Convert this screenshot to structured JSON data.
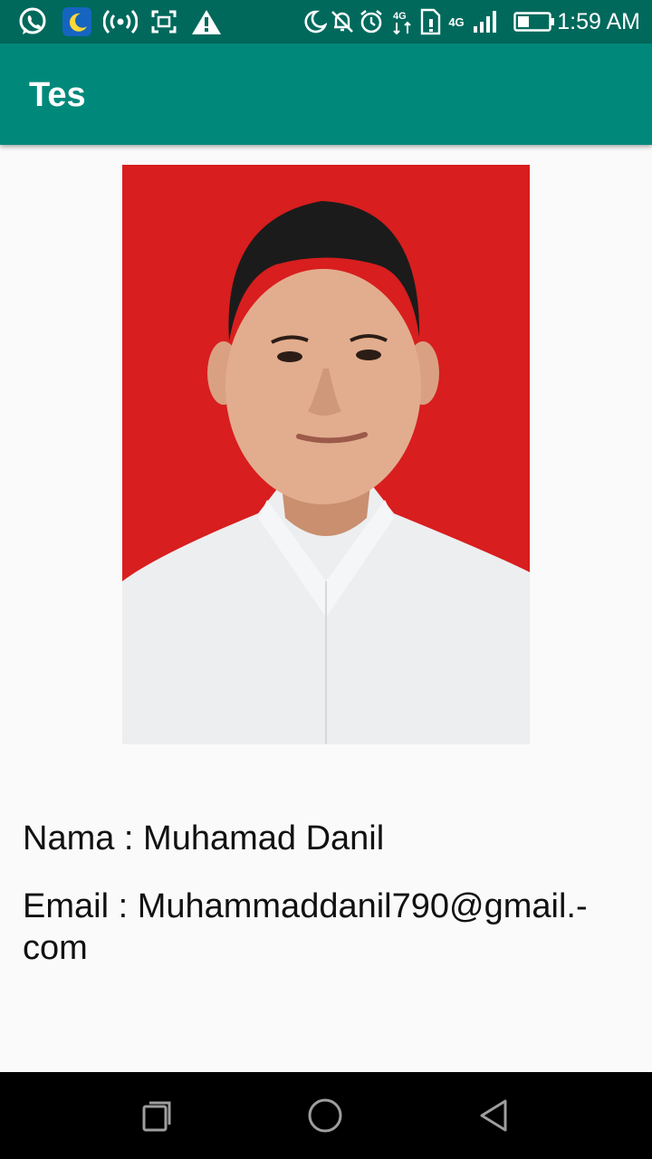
{
  "status_bar": {
    "time": "1:59 AM",
    "network_label": "4G",
    "left_icons": [
      "whatsapp-icon",
      "moon-app-icon",
      "hotspot-icon",
      "screenshot-icon",
      "warning-icon"
    ],
    "right_icons": [
      "moon-icon",
      "bell-off-icon",
      "alarm-icon",
      "data-arrows-icon",
      "sim-icon",
      "signal-icon",
      "battery-icon"
    ]
  },
  "app_bar": {
    "title": "Tes"
  },
  "profile": {
    "photo_background": "#d81e1e",
    "name_line": "Nama : Muhamad Danil",
    "email_line": "Email : Muhammaddanil790@gmail.-com"
  },
  "nav_bar": {
    "buttons": [
      "recent-apps-icon",
      "home-icon",
      "back-icon"
    ]
  },
  "colors": {
    "status_bar": "#00695c",
    "app_bar": "#00897b",
    "background": "#fafafa"
  }
}
